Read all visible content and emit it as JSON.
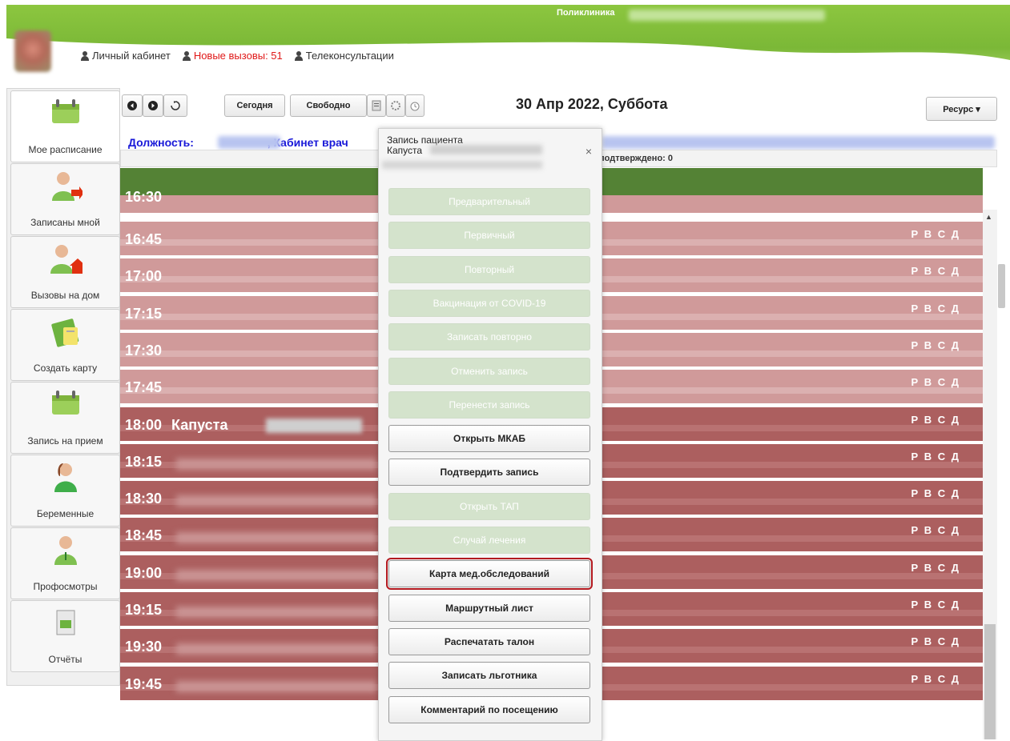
{
  "header": {
    "clinic_title": "Поликлиника",
    "links": [
      {
        "label": "Личный кабинет",
        "color": "normal"
      },
      {
        "label": "Новые вызовы: 51",
        "color": "red"
      },
      {
        "label": "Телеконсультации",
        "color": "normal"
      }
    ]
  },
  "sidebar": {
    "items": [
      {
        "label": "Мое расписание",
        "icon": "calendar-icon"
      },
      {
        "label": "Записаны мной",
        "icon": "doctor-arrow-icon"
      },
      {
        "label": "Вызовы на дом",
        "icon": "doctor-house-icon"
      },
      {
        "label": "Создать карту",
        "icon": "medical-card-icon"
      },
      {
        "label": "Запись на прием",
        "icon": "calendar-icon"
      },
      {
        "label": "Беременные",
        "icon": "pregnant-icon"
      },
      {
        "label": "Профосмотры",
        "icon": "doctor-icon"
      },
      {
        "label": "Отчёты",
        "icon": "report-icon"
      }
    ]
  },
  "toolbar": {
    "today_label": "Сегодня",
    "free_label": "Свободно",
    "date_title": "30 Апр 2022, Суббота",
    "resource_label": "Ресурс ▾"
  },
  "info": {
    "position_label": "Должность:",
    "cabinet_label": ", Кабинет врач",
    "confirmed_label": "подтверждено: 0"
  },
  "schedule": {
    "partial_time": "16:30",
    "rvsd": "Р В С Д",
    "slots": [
      {
        "time": "16:45",
        "busy": false,
        "patient": ""
      },
      {
        "time": "17:00",
        "busy": false,
        "patient": ""
      },
      {
        "time": "17:15",
        "busy": false,
        "patient": ""
      },
      {
        "time": "17:30",
        "busy": false,
        "patient": ""
      },
      {
        "time": "17:45",
        "busy": false,
        "patient": ""
      },
      {
        "time": "18:00",
        "busy": true,
        "patient": "Капуста"
      },
      {
        "time": "18:15",
        "busy": true,
        "patient": ""
      },
      {
        "time": "18:30",
        "busy": true,
        "patient": ""
      },
      {
        "time": "18:45",
        "busy": true,
        "patient": ""
      },
      {
        "time": "19:00",
        "busy": true,
        "patient": ""
      },
      {
        "time": "19:15",
        "busy": true,
        "patient": ""
      },
      {
        "time": "19:30",
        "busy": true,
        "patient": ""
      },
      {
        "time": "19:45",
        "busy": true,
        "patient": ""
      }
    ]
  },
  "popup": {
    "title": "Запись пациента",
    "patient": "Капуста",
    "close": "×",
    "buttons": [
      {
        "label": "Предварительный",
        "enabled": false,
        "highlight": false
      },
      {
        "label": "Первичный",
        "enabled": false,
        "highlight": false
      },
      {
        "label": "Повторный",
        "enabled": false,
        "highlight": false
      },
      {
        "label": "Вакцинация от COVID-19",
        "enabled": false,
        "highlight": false
      },
      {
        "label": "Записать повторно",
        "enabled": false,
        "highlight": false
      },
      {
        "label": "Отменить запись",
        "enabled": false,
        "highlight": false
      },
      {
        "label": "Перенести запись",
        "enabled": false,
        "highlight": false
      },
      {
        "label": "Открыть МКАБ",
        "enabled": true,
        "highlight": false
      },
      {
        "label": "Подтвердить запись",
        "enabled": true,
        "highlight": false
      },
      {
        "label": "Открыть ТАП",
        "enabled": false,
        "highlight": false
      },
      {
        "label": "Случай лечения",
        "enabled": false,
        "highlight": false
      },
      {
        "label": "Карта мед.обследований",
        "enabled": true,
        "highlight": true
      },
      {
        "label": "Маршрутный лист",
        "enabled": true,
        "highlight": false
      },
      {
        "label": "Распечатать талон",
        "enabled": true,
        "highlight": false
      },
      {
        "label": "Записать льготника",
        "enabled": true,
        "highlight": false
      },
      {
        "label": "Комментарий по посещению",
        "enabled": true,
        "highlight": false
      }
    ]
  },
  "colors": {
    "header_green": "#7bb837",
    "slot_free": "#d09a9a",
    "slot_busy": "#ac5f5f",
    "green_bar": "#548235",
    "disabled_btn": "#d4e3cc",
    "highlight_border": "#b3191f",
    "link_blue": "#1818d8"
  }
}
